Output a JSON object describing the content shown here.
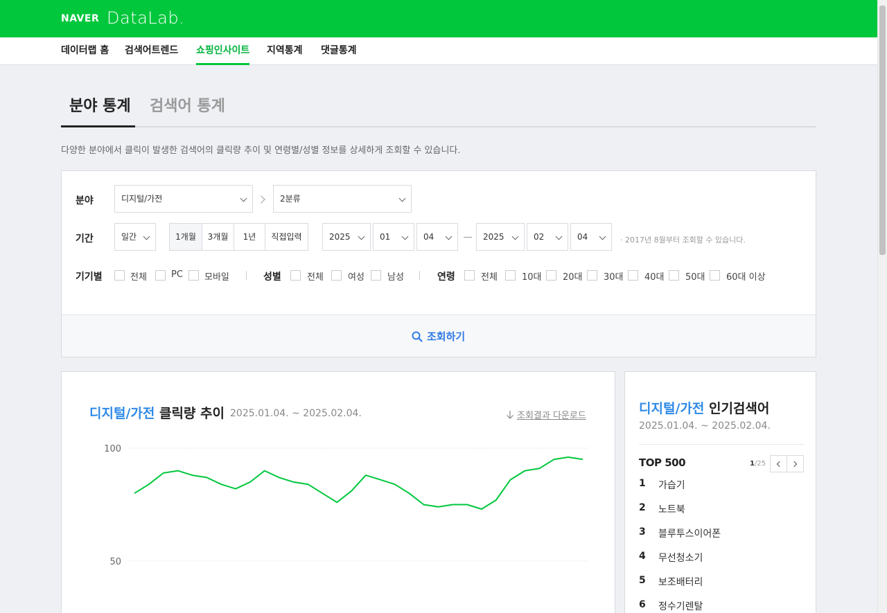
{
  "header": {
    "naver": "NAVER",
    "datalab": "DataLab."
  },
  "nav": {
    "items": [
      "데이터랩 홈",
      "검색어트렌드",
      "쇼핑인사이트",
      "지역통계",
      "댓글통계"
    ]
  },
  "tabs": {
    "active": "분야 통계",
    "inactive": "검색어 통계"
  },
  "description": "다양한 분야에서 클릭이 발생한 검색어의 클릭량 추이 및 연령별/성별 정보를 상세하게 조회할 수 있습니다.",
  "filters": {
    "category_label": "분야",
    "category1": "디지털/가전",
    "category2": "2분류",
    "period_label": "기간",
    "period_unit": "일간",
    "period_buttons": [
      "1개월",
      "3개월",
      "1년",
      "직접입력"
    ],
    "start": {
      "year": "2025",
      "month": "01",
      "day": "04"
    },
    "end": {
      "year": "2025",
      "month": "02",
      "day": "04"
    },
    "hint": "· 2017년 8월부터 조회할 수 있습니다.",
    "device_label": "기기별",
    "device_options": [
      "전체",
      "PC",
      "모바일"
    ],
    "gender_label": "성별",
    "gender_options": [
      "전체",
      "여성",
      "남성"
    ],
    "age_label": "연령",
    "age_options": [
      "전체",
      "10대",
      "20대",
      "30대",
      "40대",
      "50대",
      "60대 이상"
    ],
    "search_button": "조회하기"
  },
  "chart_section": {
    "title_highlight": "디지털/가전",
    "title_rest": "클릭량 추이",
    "date_range": "2025.01.04. ~ 2025.02.04.",
    "download": "조회결과 다운로드"
  },
  "chart_data": {
    "type": "line",
    "ylim": [
      50,
      100
    ],
    "y_ticks": [
      100,
      50
    ],
    "grid": true,
    "series": [
      {
        "color": "#00c73c",
        "values": [
          80,
          84,
          89,
          90,
          88,
          87,
          84,
          82,
          85,
          90,
          87,
          85,
          84,
          80,
          76,
          81,
          88,
          86,
          84,
          80,
          75,
          74,
          75,
          75,
          73,
          77,
          86,
          90,
          91,
          95,
          96,
          95
        ]
      }
    ]
  },
  "popular": {
    "title_highlight": "디지털/가전",
    "title_rest": "인기검색어",
    "date_range": "2025.01.04. ~ 2025.02.04.",
    "top_label": "TOP 500",
    "page_current": "1",
    "page_total": "/25",
    "items": [
      {
        "rank": "1",
        "keyword": "가습기"
      },
      {
        "rank": "2",
        "keyword": "노트북"
      },
      {
        "rank": "3",
        "keyword": "블루투스이어폰"
      },
      {
        "rank": "4",
        "keyword": "무선청소기"
      },
      {
        "rank": "5",
        "keyword": "보조배터리"
      },
      {
        "rank": "6",
        "keyword": "정수기렌탈"
      }
    ]
  },
  "colors": {
    "brand_green": "#00c73c",
    "accent_blue": "#2f8ae6"
  }
}
